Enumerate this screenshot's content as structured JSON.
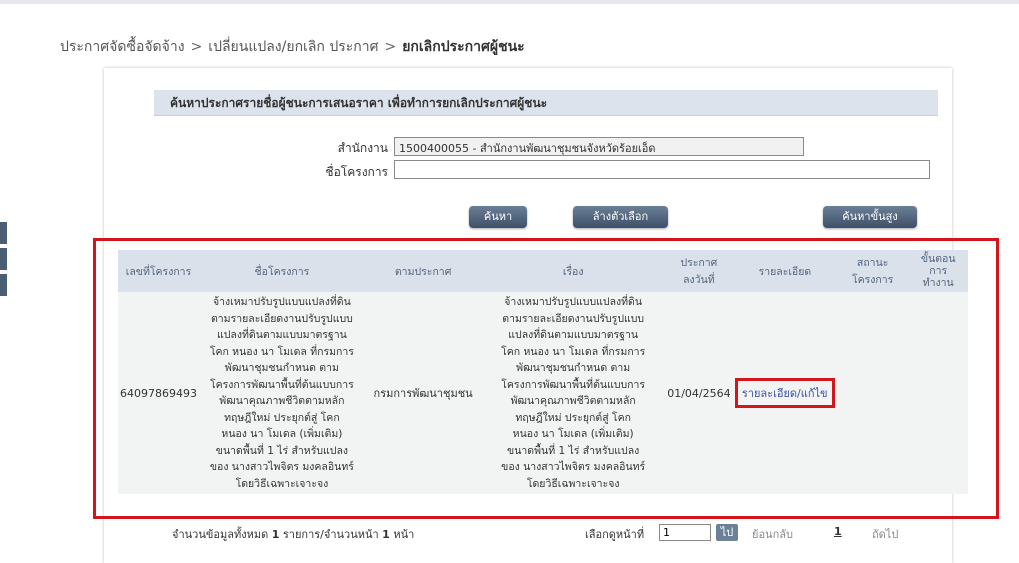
{
  "breadcrumb": {
    "item1": "ประกาศจัดซื้อจัดจ้าง",
    "item2": "เปลี่ยนแปลง/ยกเลิก ประกาศ",
    "current": "ยกเลิกประกาศผู้ชนะ",
    "separator": ">"
  },
  "search": {
    "heading": "ค้นหาประกาศรายชื่อผู้ชนะการเสนอราคา เพื่อทำการยกเลิกประกาศผู้ชนะ",
    "office_label": "สำนักงาน",
    "office_value": "1500400055 - สำนักงานพัฒนาชุมชนจังหวัดร้อยเอ็ด",
    "project_label": "ชื่อโครงการ",
    "project_value": "",
    "search_button": "ค้นหา",
    "clear_button": "ล้างตัวเลือก",
    "advanced_button": "ค้นหาขั้นสูง"
  },
  "table": {
    "headers": {
      "project_no": "เลขที่โครงการ",
      "project_name": "ชื่อโครงการ",
      "per_announcement": "ตามประกาศ",
      "subject": "เรื่อง",
      "date": [
        "ประกาศ",
        "ลงวันที่"
      ],
      "detail": "รายละเอียด",
      "status": [
        "สถานะ",
        "โครงการ"
      ],
      "step": [
        "ขั้นตอน",
        "การ",
        "ทำงาน"
      ]
    },
    "row": {
      "project_no": "64097869493",
      "name_lines": [
        "จ้างเหมาปรับรูปแบบแปลงที่ดิน",
        "ตามรายละเอียดงานปรับรูปแบบ",
        "แปลงที่ดินตามแบบมาตรฐาน",
        "โคก หนอง นา โมเดล ที่กรมการ",
        "พัฒนาชุมชนกำหนด ตาม",
        "โครงการพัฒนาพื้นที่ต้นแบบการ",
        "พัฒนาคุณภาพชีวิตตามหลัก",
        "ทฤษฎีใหม่ ประยุกต์สู่ โคก",
        "หนอง นา โมเดล (เพิ่มเติม)",
        "ขนาดพื้นที่ 1 ไร่ สำหรับแปลง",
        "ของ นางสาวไพจิตร มงคลอินทร์",
        "โดยวิธีเฉพาะเจาะจง"
      ],
      "agency": "กรมการพัฒนาชุมชน",
      "date": "01/04/2564",
      "detail_link": "รายละเอียด/แก้ไข",
      "status": "",
      "step": ""
    }
  },
  "pager": {
    "total_prefix": "จำนวนข้อมูลทั้งหมด",
    "total_count": "1",
    "total_mid": "รายการ/จำนวนหน้า",
    "page_count": "1",
    "page_suffix": "หน้า",
    "goto_label": "เลือกดูหน้าที่",
    "goto_value": "1",
    "go_button": "ไป",
    "prev": "ย้อนกลับ",
    "current_page": "1",
    "next": "ถัดไป"
  },
  "colors": {
    "highlight": "#d2161c",
    "header_bg": "#dbe1ea",
    "button": "#4b5d73",
    "link": "#3b4fa8"
  }
}
